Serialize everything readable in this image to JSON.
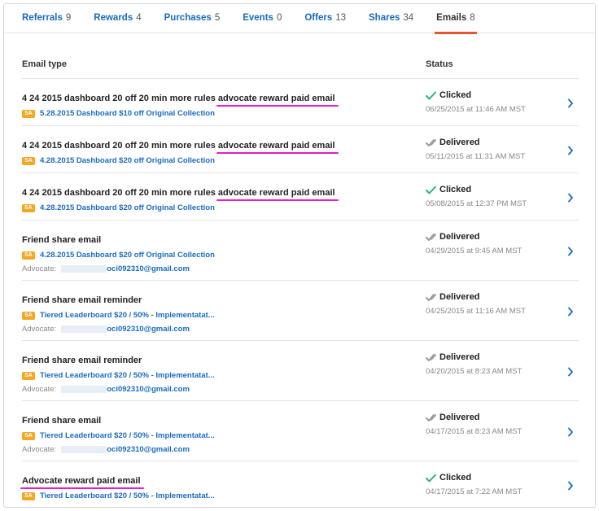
{
  "tabs": [
    {
      "label": "Referrals",
      "count": "9",
      "active": false
    },
    {
      "label": "Rewards",
      "count": "4",
      "active": false
    },
    {
      "label": "Purchases",
      "count": "5",
      "active": false
    },
    {
      "label": "Events",
      "count": "0",
      "active": false
    },
    {
      "label": "Offers",
      "count": "13",
      "active": false
    },
    {
      "label": "Shares",
      "count": "34",
      "active": false
    },
    {
      "label": "Emails",
      "count": "8",
      "active": true
    }
  ],
  "table": {
    "headers": {
      "email_type": "Email type",
      "status": "Status"
    },
    "badge_text": "SA",
    "advocate_label": "Advocate:",
    "rows": [
      {
        "title_prefix": "4 24 2015 dashboard 20 off 20 min more rules ",
        "title_highlight": "advocate reward paid email",
        "campaign": "5.28.2015 Dashboard $10 off Original Collection",
        "advocate_email": "",
        "status": "Clicked",
        "timestamp": "06/25/2015 at 11:46 AM MST"
      },
      {
        "title_prefix": "4 24 2015 dashboard 20 off 20 min more rules ",
        "title_highlight": "advocate reward paid email",
        "campaign": "4.28.2015 Dashboard $20 off Original Collection",
        "advocate_email": "",
        "status": "Delivered",
        "timestamp": "05/11/2015 at 11:31 AM MST"
      },
      {
        "title_prefix": "4 24 2015 dashboard 20 off 20 min more rules ",
        "title_highlight": "advocate reward paid email",
        "campaign": "4.28.2015 Dashboard $20 off Original Collection",
        "advocate_email": "",
        "status": "Clicked",
        "timestamp": "05/08/2015 at 12:37 PM MST"
      },
      {
        "title_prefix": "Friend share email",
        "title_highlight": "",
        "campaign": "4.28.2015 Dashboard $20 off Original Collection",
        "advocate_email": "oci092310@gmail.com",
        "status": "Delivered",
        "timestamp": "04/29/2015 at 9:45 AM MST"
      },
      {
        "title_prefix": "Friend share email reminder",
        "title_highlight": "",
        "campaign": "Tiered Leaderboard $20 / 50% - Implementatat...",
        "advocate_email": "oci092310@gmail.com",
        "status": "Delivered",
        "timestamp": "04/25/2015 at 11:16 AM MST"
      },
      {
        "title_prefix": "Friend share email reminder",
        "title_highlight": "",
        "campaign": "Tiered Leaderboard $20 / 50% - Implementatat...",
        "advocate_email": "oci092310@gmail.com",
        "status": "Delivered",
        "timestamp": "04/20/2015 at 8:23 AM MST"
      },
      {
        "title_prefix": "Friend share email",
        "title_highlight": "",
        "campaign": "Tiered Leaderboard $20 / 50% - Implementatat...",
        "advocate_email": "oci092310@gmail.com",
        "status": "Delivered",
        "timestamp": "04/17/2015 at 8:23 AM MST"
      },
      {
        "title_prefix": "",
        "title_highlight": "Advocate reward paid email",
        "campaign": "Tiered Leaderboard $20 / 50% - Implementatat...",
        "advocate_email": "",
        "status": "Clicked",
        "timestamp": "04/17/2015 at 7:22 AM MST"
      }
    ]
  },
  "colors": {
    "link": "#1a6bc2",
    "active_tab_underline": "#e4572e",
    "clicked_check": "#2bb673",
    "delivered_check": "#9a9a9a",
    "highlight": "#e020c8",
    "badge": "#f5a623"
  },
  "icons": {
    "clicked": "check-icon",
    "delivered": "double-check-icon",
    "row_action": "chevron-right-icon"
  }
}
